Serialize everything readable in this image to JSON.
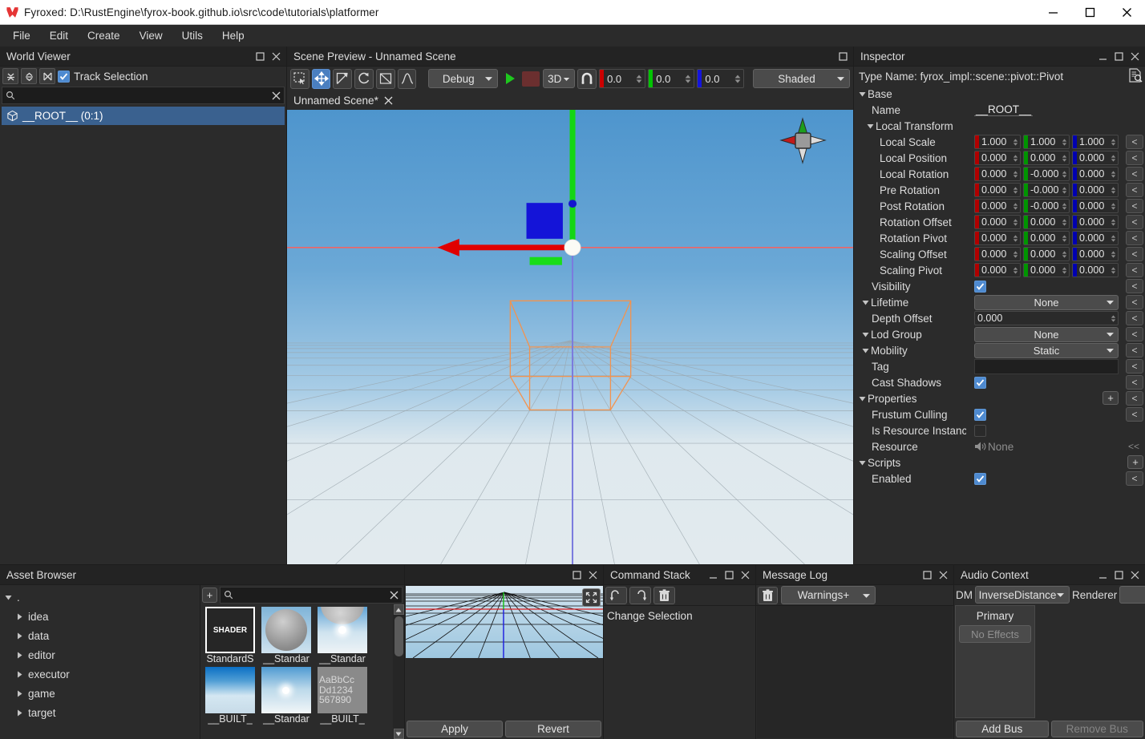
{
  "window": {
    "title": "Fyroxed: D:\\RustEngine\\fyrox-book.github.io\\src\\code\\tutorials\\platformer",
    "logo_icon": "fyrox-logo-icon",
    "minimize_icon": "minimize-icon",
    "maximize_icon": "maximize-icon",
    "close_icon": "close-icon"
  },
  "menubar": {
    "items": [
      {
        "label": "File"
      },
      {
        "label": "Edit"
      },
      {
        "label": "Create"
      },
      {
        "label": "View"
      },
      {
        "label": "Utils"
      },
      {
        "label": "Help"
      }
    ]
  },
  "world_viewer": {
    "title": "World Viewer",
    "toolbar": [
      {
        "icon": "collapse-all-icon"
      },
      {
        "icon": "expand-all-icon"
      },
      {
        "icon": "locate-selection-icon"
      }
    ],
    "track_selection": {
      "label": "Track Selection",
      "checked": true
    },
    "search": {
      "value": "",
      "placeholder": "",
      "search_icon": "search-icon",
      "clear_icon": "clear-icon"
    },
    "tree": [
      {
        "icon": "cube-icon",
        "label": "__ROOT__  (0:1)",
        "selected": true
      }
    ]
  },
  "scene_preview": {
    "title": "Scene Preview - Unnamed Scene",
    "tools": [
      {
        "icon": "select-rect-icon",
        "active": false
      },
      {
        "icon": "move-gizmo-icon",
        "active": true
      },
      {
        "icon": "scale-gizmo-icon",
        "active": false
      },
      {
        "icon": "rotate-gizmo-icon",
        "active": false
      },
      {
        "icon": "navmesh-icon",
        "active": false
      },
      {
        "icon": "terrain-icon",
        "active": false
      }
    ],
    "build_profile": "Debug",
    "play_icon": "play-icon",
    "stop_icon": "stop-icon",
    "mode": "3D",
    "snap_icon": "magnet-icon",
    "snap_x": "0.0",
    "snap_y": "0.0",
    "snap_z": "0.0",
    "render_mode": "Shaded",
    "tab": {
      "label": "Unnamed Scene*",
      "close_icon": "close-icon"
    },
    "axis_gizmo": "axis-orientation-gizmo"
  },
  "inspector": {
    "title": "Inspector",
    "docs_icon": "documentation-icon",
    "type_name": "Type Name: fyrox_impl::scene::pivot::Pivot",
    "reset_label": "<",
    "reset_wide_label": "<<",
    "plus_label": "+",
    "sections": {
      "base": "Base",
      "local_transform": "Local Transform",
      "properties": "Properties",
      "scripts": "Scripts"
    },
    "fields": {
      "name": {
        "label": "Name",
        "value": "__ROOT__"
      },
      "local_scale": {
        "label": "Local Scale",
        "x": "1.000",
        "y": "1.000",
        "z": "1.000"
      },
      "local_position": {
        "label": "Local Position",
        "x": "0.000",
        "y": "0.000",
        "z": "0.000"
      },
      "local_rotation": {
        "label": "Local Rotation",
        "x": "0.000",
        "y": "-0.000",
        "z": "0.000"
      },
      "pre_rotation": {
        "label": "Pre Rotation",
        "x": "0.000",
        "y": "-0.000",
        "z": "0.000"
      },
      "post_rotation": {
        "label": "Post Rotation",
        "x": "0.000",
        "y": "-0.000",
        "z": "0.000"
      },
      "rotation_offset": {
        "label": "Rotation Offset",
        "x": "0.000",
        "y": "0.000",
        "z": "0.000"
      },
      "rotation_pivot": {
        "label": "Rotation Pivot",
        "x": "0.000",
        "y": "0.000",
        "z": "0.000"
      },
      "scaling_offset": {
        "label": "Scaling Offset",
        "x": "0.000",
        "y": "0.000",
        "z": "0.000"
      },
      "scaling_pivot": {
        "label": "Scaling Pivot",
        "x": "0.000",
        "y": "0.000",
        "z": "0.000"
      },
      "visibility": {
        "label": "Visibility",
        "checked": true
      },
      "lifetime": {
        "label": "Lifetime",
        "value": "None"
      },
      "depth_offset": {
        "label": "Depth Offset",
        "value": "0.000"
      },
      "lod_group": {
        "label": "Lod Group",
        "value": "None"
      },
      "mobility": {
        "label": "Mobility",
        "value": "Static"
      },
      "tag": {
        "label": "Tag",
        "value": ""
      },
      "cast_shadows": {
        "label": "Cast Shadows",
        "checked": true
      },
      "frustum_culling": {
        "label": "Frustum Culling",
        "checked": true
      },
      "is_resource_instance": {
        "label": "Is Resource Instanc",
        "checked": false
      },
      "resource": {
        "label": "Resource",
        "value": "None",
        "icon": "speaker-icon"
      },
      "enabled": {
        "label": "Enabled",
        "checked": true
      }
    },
    "axis_colors": {
      "x": "#b30000",
      "y": "#00a000",
      "z": "#0000b5"
    }
  },
  "asset_browser": {
    "title": "Asset Browser",
    "maximize_icon": "maximize-icon",
    "close_icon": "close-icon",
    "root": ".",
    "folders": [
      {
        "label": "idea"
      },
      {
        "label": "data"
      },
      {
        "label": "editor"
      },
      {
        "label": "executor"
      },
      {
        "label": "game"
      },
      {
        "label": "target"
      }
    ],
    "add_label": "+",
    "search": {
      "value": "",
      "search_icon": "search-icon",
      "clear_icon": "clear-icon"
    },
    "assets": [
      {
        "name": "StandardS",
        "thumb": "shader",
        "thumb_text": "SHADER",
        "selected": true
      },
      {
        "name": "__Standar",
        "thumb": "sphere-material",
        "selected": false
      },
      {
        "name": "__Standar",
        "thumb": "sphere-sky",
        "selected": false
      },
      {
        "name": "__BUILT_",
        "thumb": "gradient-blue",
        "selected": false
      },
      {
        "name": "__Standar",
        "thumb": "light-sky",
        "selected": false
      },
      {
        "name": "__BUILT_",
        "thumb": "font",
        "thumb_text": "AaBbCc Dd1234 567890",
        "selected": false
      }
    ]
  },
  "preview_dock": {
    "maximize_icon": "maximize-icon",
    "close_icon": "close-icon",
    "fit_icon": "fit-to-view-icon",
    "apply_label": "Apply",
    "revert_label": "Revert"
  },
  "command_stack": {
    "title": "Command Stack",
    "minimize_icon": "minimize-icon",
    "maximize_icon": "maximize-icon",
    "close_icon": "close-icon",
    "undo_icon": "undo-icon",
    "redo_icon": "redo-icon",
    "clear_icon": "trash-icon",
    "items": [
      {
        "label": "Change Selection"
      }
    ]
  },
  "message_log": {
    "title": "Message Log",
    "maximize_icon": "maximize-icon",
    "close_icon": "close-icon",
    "clear_icon": "trash-icon",
    "severity": "Warnings+",
    "entries": []
  },
  "audio_context": {
    "title": "Audio Context",
    "minimize_icon": "minimize-icon",
    "maximize_icon": "maximize-icon",
    "close_icon": "close-icon",
    "dm_label": "DM",
    "distance_model": "InverseDistance",
    "renderer_label": "Renderer",
    "renderer_value": "",
    "bus": {
      "name": "Primary",
      "effects_placeholder": "No Effects"
    },
    "add_bus_label": "Add Bus",
    "remove_bus_label": "Remove Bus"
  },
  "colors": {
    "accent_blue": "#4e8ad0",
    "selection_blue": "#3a618f",
    "panel_bg": "#2b2b2b",
    "panel_head": "#232323",
    "gizmo_x": "#dd0000",
    "gizmo_y": "#00d000",
    "gizmo_z": "#4040cc",
    "bbox_orange": "#f0934e",
    "play_green": "#22c022",
    "stop_red": "#6b2f2f"
  }
}
